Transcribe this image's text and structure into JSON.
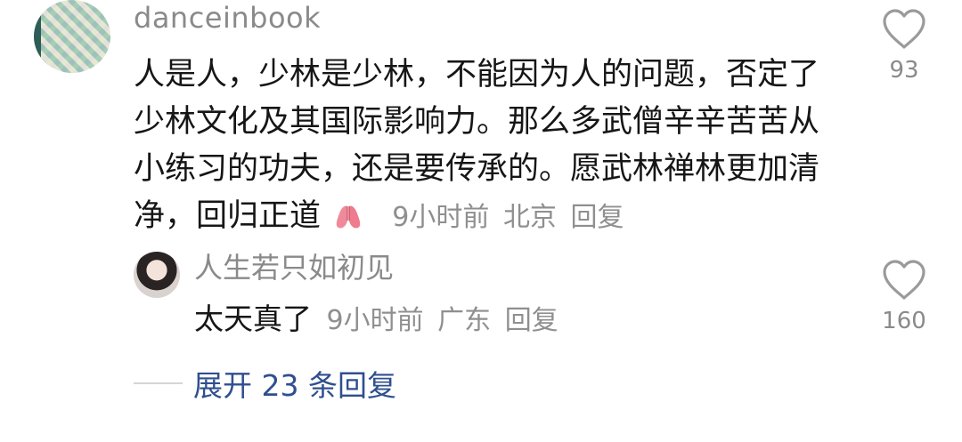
{
  "main_comment": {
    "username": "danceinbook",
    "text": "人是人，少林是少林，不能因为人的问题，否定了少林文化及其国际影响力。那么多武僧辛辛苦苦从小练习的功夫，还是要传承的。愿武林禅林更加清净，回归正道",
    "emoji": "pray-emoji",
    "time": "9小时前",
    "location": "北京",
    "reply_label": "回复",
    "likes": "93"
  },
  "reply_comment": {
    "username": "人生若只如初见",
    "text": "太天真了",
    "time": "9小时前",
    "location": "广东",
    "reply_label": "回复",
    "likes": "160"
  },
  "expand": {
    "label": "展开 23 条回复"
  },
  "colors": {
    "username": "#8a8a8a",
    "text": "#161616",
    "meta": "#8f8f8f",
    "expand_link": "#2f4f8f"
  }
}
